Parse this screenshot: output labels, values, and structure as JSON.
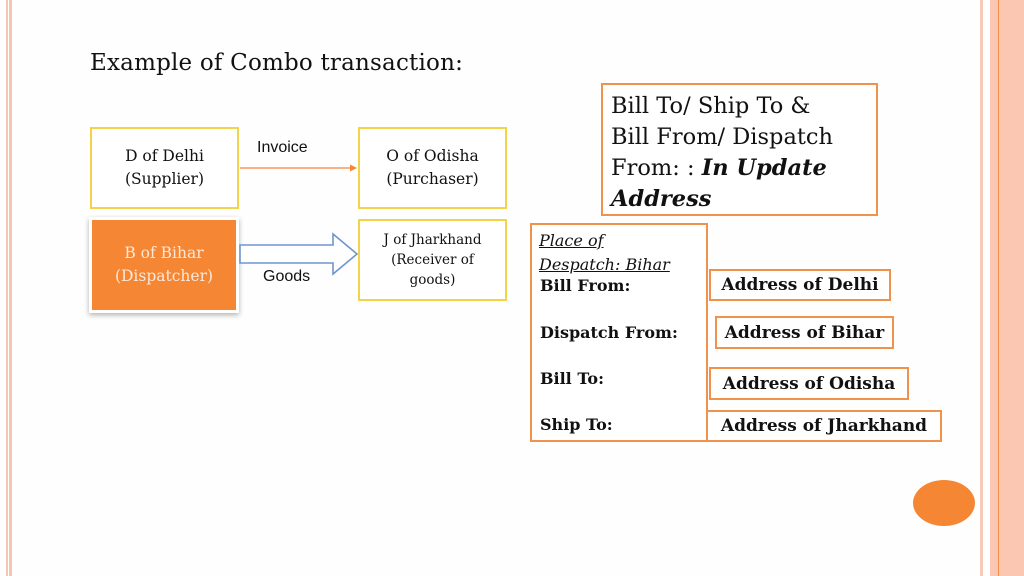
{
  "slide": {
    "title": "Example of Combo transaction:",
    "accent_color": "#f58634",
    "node_border_color": "#f3d34a",
    "box_border_color": "#f0924c"
  },
  "diagram": {
    "nodes": [
      {
        "id": "delhi",
        "line1": "D of Delhi",
        "line2": "(Supplier)"
      },
      {
        "id": "odisha",
        "line1": "O of Odisha",
        "line2": "(Purchaser)"
      },
      {
        "id": "bihar",
        "line1": "B of Bihar",
        "line2": "(Dispatcher)"
      },
      {
        "id": "jharkhand",
        "line1": "J of Jharkhand",
        "line2": "(Receiver of",
        "line3": "goods)"
      }
    ],
    "edges": [
      {
        "from": "delhi",
        "to": "odisha",
        "label": "Invoice"
      },
      {
        "from": "bihar",
        "to": "jharkhand",
        "label": "Goods"
      }
    ]
  },
  "note": {
    "line1": "Bill To/ Ship To &",
    "line2": "Bill From/ Dispatch",
    "line3_prefix": "From: : ",
    "emphasis1": "In Update",
    "emphasis2": "Address"
  },
  "address_panel": {
    "place_line1": "Place of",
    "place_line2": "Despatch: Bihar",
    "rows": [
      {
        "label": "Bill From:",
        "value": "Address of Delhi"
      },
      {
        "label": "Dispatch From:",
        "value": "Address of Bihar"
      },
      {
        "label": "Bill To:",
        "value": "Address of Odisha"
      },
      {
        "label": "Ship To:",
        "value": "Address of Jharkhand"
      }
    ]
  }
}
